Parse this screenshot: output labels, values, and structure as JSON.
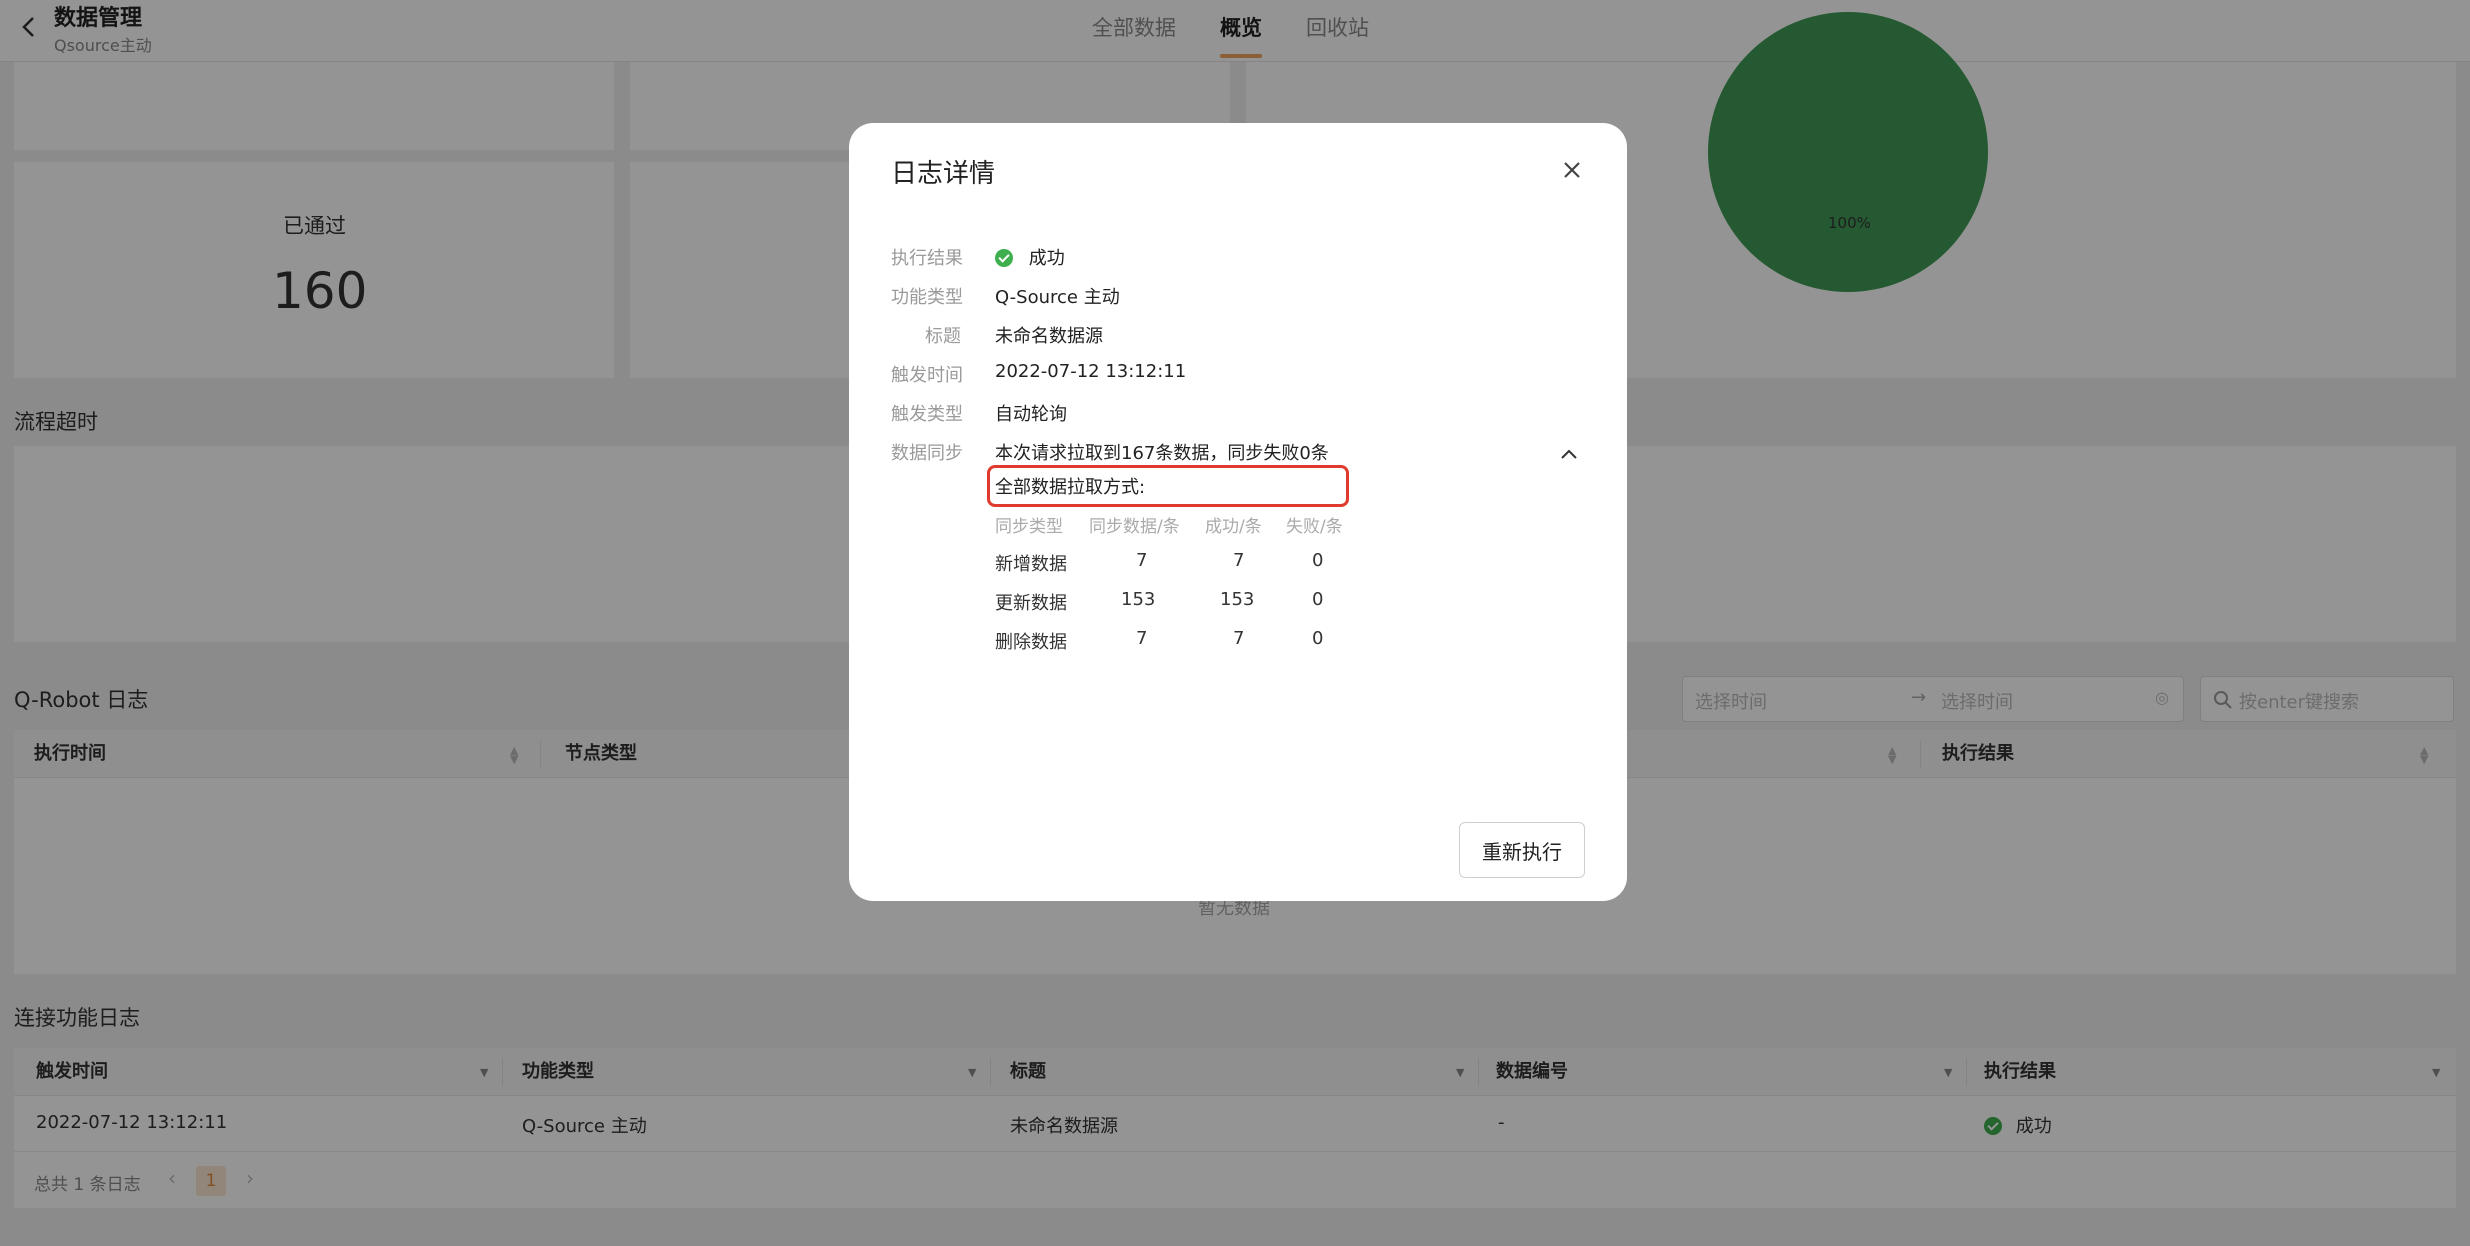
{
  "header": {
    "title": "数据管理",
    "subtitle": "Qsource主动",
    "tabs": [
      {
        "label": "全部数据",
        "active": false
      },
      {
        "label": "概览",
        "active": true
      },
      {
        "label": "回收站",
        "active": false
      }
    ]
  },
  "overview": {
    "passed_label": "已通过",
    "passed_value": "160",
    "pie_label": "100%",
    "pie_color": "#3f9a55"
  },
  "timeout_section": {
    "title": "流程超时"
  },
  "robot_log": {
    "title": "Q-Robot 日志",
    "start_placeholder": "选择时间",
    "end_placeholder": "选择时间",
    "search_placeholder": "按enter键搜索",
    "columns": [
      "执行时间",
      "节点类型",
      "执行结果"
    ],
    "empty_text": "暂无数据"
  },
  "connect_log": {
    "title": "连接功能日志",
    "columns": [
      "触发时间",
      "功能类型",
      "标题",
      "数据编号",
      "执行结果"
    ],
    "rows": [
      {
        "time": "2022-07-12 13:12:11",
        "type": "Q-Source 主动",
        "title": "未命名数据源",
        "number": "-",
        "result": "成功"
      }
    ],
    "total_text": "总共 1 条日志",
    "page": "1"
  },
  "modal": {
    "title": "日志详情",
    "fields": {
      "result_label": "执行结果",
      "result_value": "成功",
      "type_label": "功能类型",
      "type_value": "Q-Source 主动",
      "title_label": "标题",
      "title_value": "未命名数据源",
      "trigger_time_label": "触发时间",
      "trigger_time_value": "2022-07-12 13:12:11",
      "trigger_type_label": "触发类型",
      "trigger_type_value": "自动轮询",
      "sync_label": "数据同步",
      "sync_summary": "本次请求拉取到167条数据，同步失败0条"
    },
    "pull_mode": "全部数据拉取方式:",
    "sync_table": {
      "headers": [
        "同步类型",
        "同步数据/条",
        "成功/条",
        "失败/条"
      ],
      "rows": [
        [
          "新增数据",
          "7",
          "7",
          "0"
        ],
        [
          "更新数据",
          "153",
          "153",
          "0"
        ],
        [
          "删除数据",
          "7",
          "7",
          "0"
        ]
      ]
    },
    "rerun_label": "重新执行",
    "accent_color": "#e0392d",
    "success_color": "#3fae4e"
  }
}
